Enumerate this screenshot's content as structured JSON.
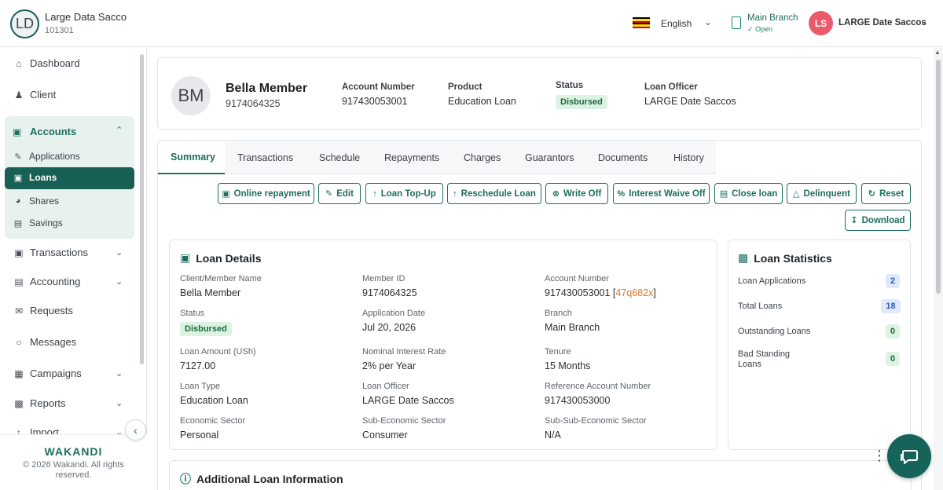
{
  "header": {
    "org_initials": "LD",
    "org_name": "Large Data Sacco",
    "org_code": "101301",
    "language": "English",
    "branch_name": "Main Branch",
    "branch_status": "Open",
    "user_initials": "LS",
    "user_name": "LARGE Date Saccos",
    "colors": {
      "accent": "#1d6f5e",
      "user_avatar": "#e95a6a"
    }
  },
  "sidebar": {
    "items": {
      "dashboard": "Dashboard",
      "client": "Client",
      "accounts": "Accounts",
      "transactions": "Transactions",
      "accounting": "Accounting",
      "requests": "Requests",
      "messages": "Messages",
      "campaigns": "Campaigns",
      "reports": "Reports",
      "import": "Import"
    },
    "accounts_sub": {
      "applications": "Applications",
      "loans": "Loans",
      "shares": "Shares",
      "savings": "Savings"
    },
    "brand": "WAKANDI",
    "copyright": "© 2026 Wakandi. All rights reserved."
  },
  "profile": {
    "initials": "BM",
    "name": "Bella Member",
    "member_id": "9174064325",
    "account_number_label": "Account Number",
    "account_number": "917430053001",
    "product_label": "Product",
    "product": "Education Loan",
    "status_label": "Status",
    "status": "Disbursed",
    "loan_officer_label": "Loan Officer",
    "loan_officer": "LARGE Date Saccos"
  },
  "tabs": [
    "Summary",
    "Transactions",
    "Schedule",
    "Repayments",
    "Charges",
    "Guarantors",
    "Documents",
    "History"
  ],
  "actions": {
    "online_repayment": "Online repayment",
    "edit": "Edit",
    "loan_topup": "Loan Top-Up",
    "reschedule": "Reschedule Loan",
    "write_off": "Write Off",
    "interest_waive_off": "Interest Waive Off",
    "close_loan": "Close loan",
    "delinquent": "Delinquent",
    "reset": "Reset",
    "download": "Download"
  },
  "loan_details": {
    "title": "Loan Details",
    "client_name_label": "Client/Member Name",
    "client_name": "Bella Member",
    "member_id_label": "Member ID",
    "member_id": "9174064325",
    "account_number_label": "Account Number",
    "account_number": "917430053001",
    "account_ref": "47q682x",
    "status_label": "Status",
    "status": "Disbursed",
    "application_date_label": "Application Date",
    "application_date": "Jul 20, 2026",
    "branch_label": "Branch",
    "branch": "Main Branch",
    "loan_amount_label": "Loan Amount (USh)",
    "loan_amount": "7127.00",
    "interest_rate_label": "Nominal Interest Rate",
    "interest_rate": "2% per Year",
    "tenure_label": "Tenure",
    "tenure": "15 Months",
    "loan_type_label": "Loan Type",
    "loan_type": "Education Loan",
    "loan_officer_label": "Loan Officer",
    "loan_officer": "LARGE Date Saccos",
    "reference_account_label": "Reference Account Number",
    "reference_account": "917430053000",
    "economic_sector_label": "Economic Sector",
    "economic_sector": "Personal",
    "sub_economic_sector_label": "Sub-Economic Sector",
    "sub_economic_sector": "Consumer",
    "sub_sub_economic_sector_label": "Sub-Sub-Economic Sector",
    "sub_sub_economic_sector": "N/A"
  },
  "loan_statistics": {
    "title": "Loan Statistics",
    "applications_label": "Loan Applications",
    "applications": "2",
    "total_label": "Total Loans",
    "total": "18",
    "outstanding_label": "Outstanding Loans",
    "outstanding": "0",
    "bad_standing_label": "Bad Standing Loans",
    "bad_standing": "0"
  },
  "additional": {
    "title": "Additional Loan Information"
  }
}
